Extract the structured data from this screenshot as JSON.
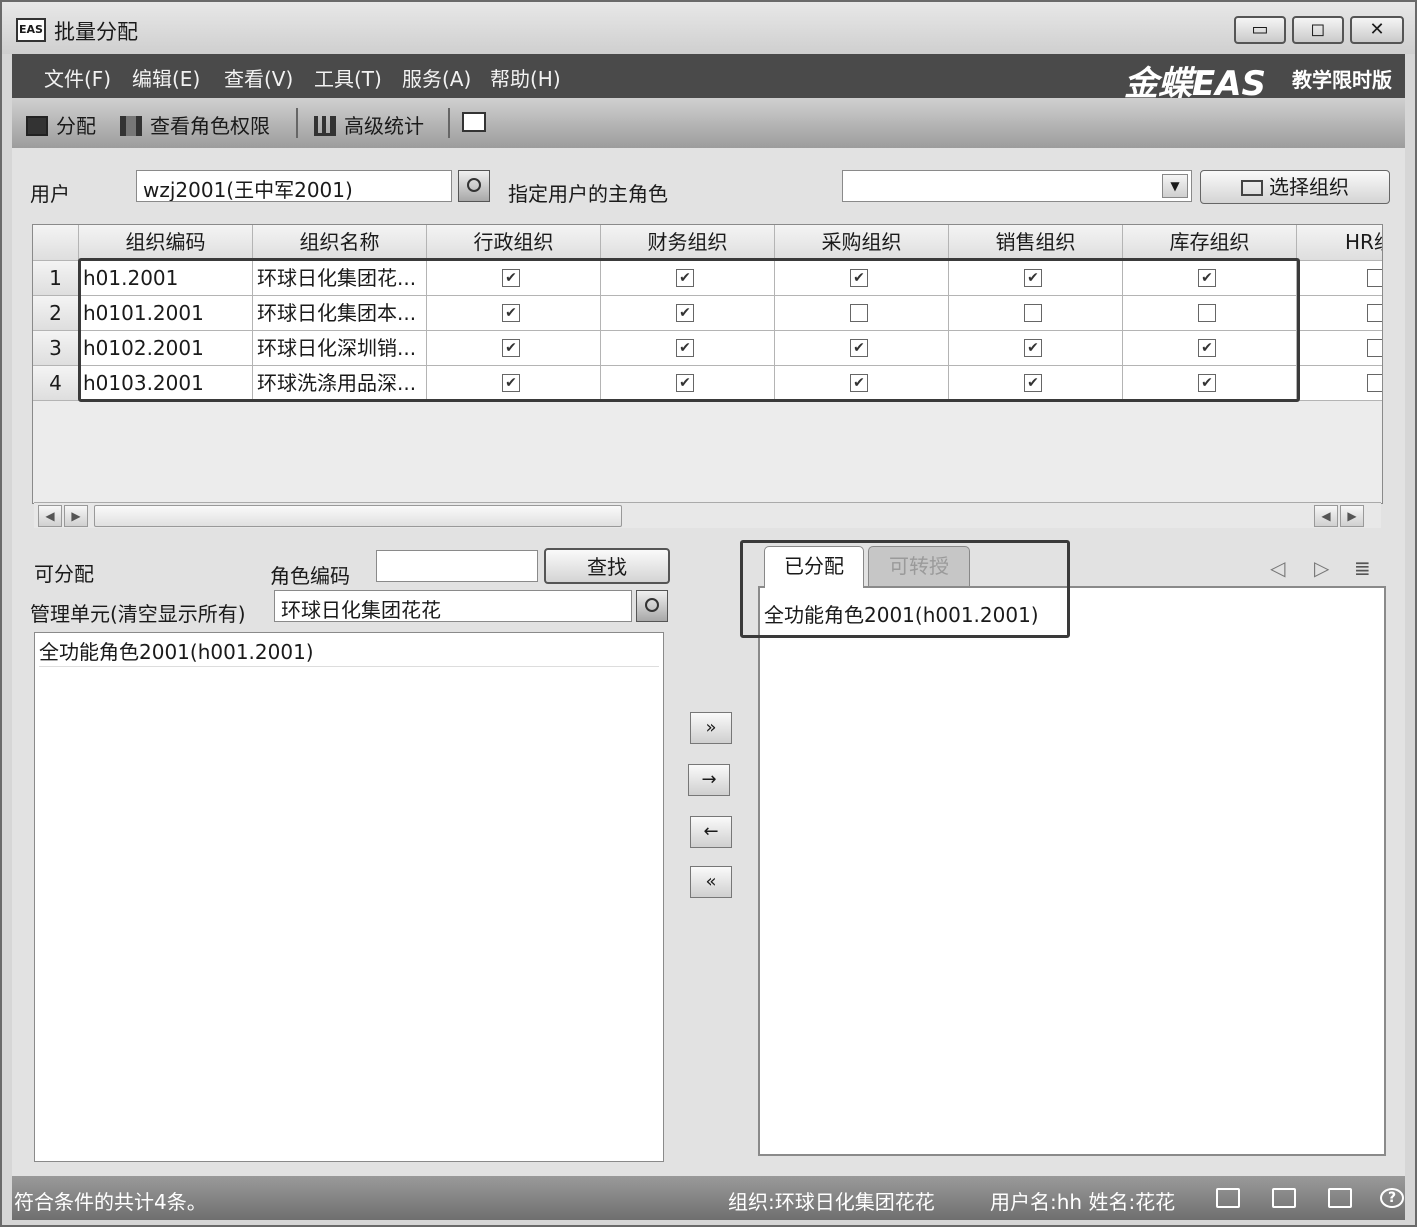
{
  "window": {
    "app_icon": "EAS",
    "title": "批量分配",
    "controls": {
      "minimize": "▭",
      "maximize": "◻",
      "close": "✕"
    }
  },
  "menu": {
    "items": [
      "文件(F)",
      "编辑(E)",
      "查看(V)",
      "工具(T)",
      "服务(A)",
      "帮助(H)"
    ],
    "brand": "金蝶EAS",
    "edition": "教学限时版"
  },
  "toolbar": {
    "assign": "分配",
    "view_role_rights": "查看角色权限",
    "advanced_stats": "高级统计",
    "exit_icon": "exit-icon"
  },
  "form": {
    "user_label": "用户",
    "user_value": "wzj2001(王中军2001)",
    "main_role_label": "指定用户的主角色",
    "main_role_value": "",
    "select_org_button": "选择组织"
  },
  "org_grid": {
    "columns": [
      "组织编码",
      "组织名称",
      "行政组织",
      "财务组织",
      "采购组织",
      "销售组织",
      "库存组织",
      "HR组"
    ],
    "rows": [
      {
        "num": "1",
        "code": "h01.2001",
        "name": "环球日化集团花...",
        "checks": [
          true,
          true,
          true,
          true,
          true,
          false
        ]
      },
      {
        "num": "2",
        "code": "h0101.2001",
        "name": "环球日化集团本...",
        "checks": [
          true,
          true,
          false,
          false,
          false,
          false
        ]
      },
      {
        "num": "3",
        "code": "h0102.2001",
        "name": "环球日化深圳销...",
        "checks": [
          true,
          true,
          true,
          true,
          true,
          false
        ]
      },
      {
        "num": "4",
        "code": "h0103.2001",
        "name": "环球洗涤用品深...",
        "checks": [
          true,
          true,
          true,
          true,
          true,
          false
        ]
      }
    ]
  },
  "available": {
    "label": "可分配",
    "role_code_label": "角色编码",
    "role_code_value": "",
    "find_button": "查找",
    "admin_unit_label": "管理单元(清空显示所有)",
    "admin_unit_value": "环球日化集团花花",
    "items": [
      "全功能角色2001(h001.2001)"
    ]
  },
  "move_buttons": {
    "add_all": "»",
    "add": "→",
    "remove": "←",
    "remove_all": "«"
  },
  "assigned": {
    "tab_assigned": "已分配",
    "tab_transferable": "可转授",
    "items": [
      "全功能角色2001(h001.2001)"
    ]
  },
  "status": {
    "count_text": "符合条件的共计4条。",
    "org_text": "组织:环球日化集团花花",
    "user_text": "用户名:hh  姓名:花花"
  },
  "colors": {
    "menubar": "#4a4a4a",
    "statusbar": "#7a7a7a",
    "content": "#e2e2e2"
  }
}
